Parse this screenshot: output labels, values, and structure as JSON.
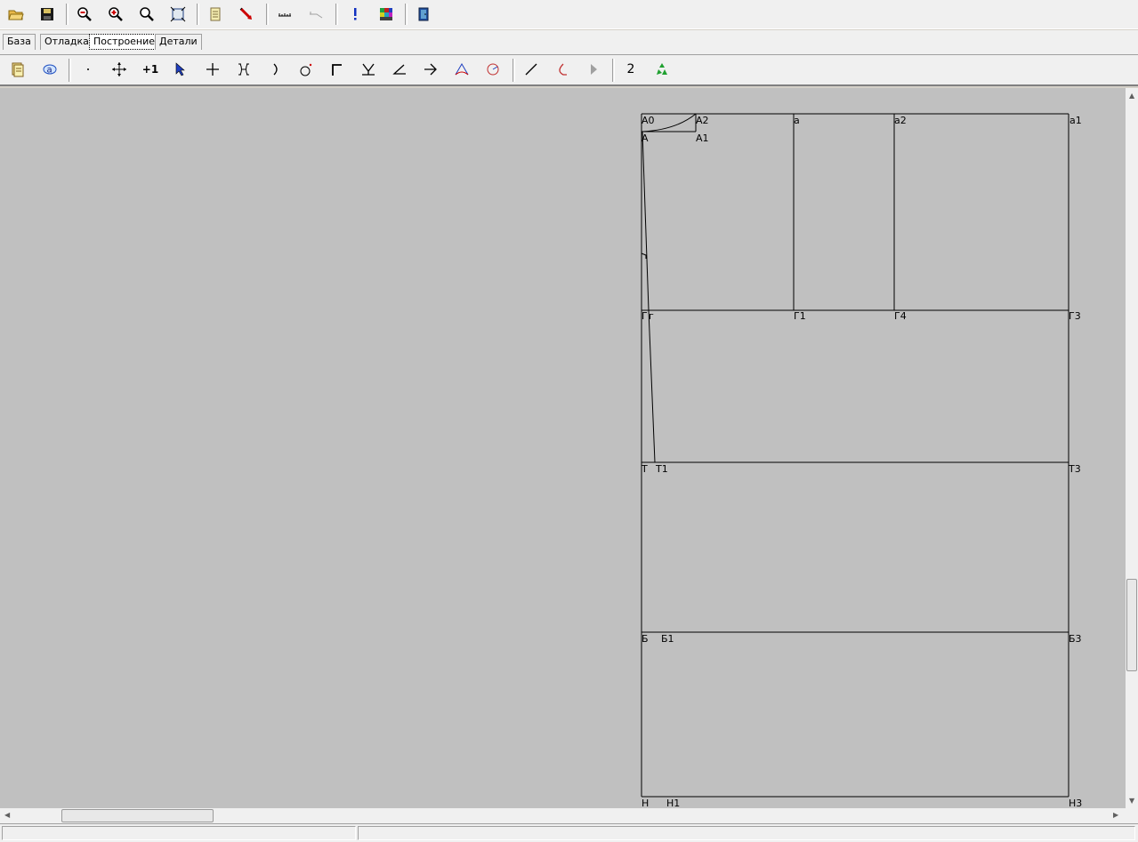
{
  "toolbar_top": {
    "buttons": [
      {
        "name": "open-folder-icon"
      },
      {
        "name": "save-icon"
      },
      {
        "name": "zoom-out-icon"
      },
      {
        "name": "zoom-in-icon"
      },
      {
        "name": "zoom-icon"
      },
      {
        "name": "fit-to-window-icon"
      },
      {
        "name": "notes-icon"
      },
      {
        "name": "pointer-red-icon"
      },
      {
        "name": "ruler-icon"
      },
      {
        "name": "measure-disabled-icon"
      },
      {
        "name": "exclamation-icon"
      },
      {
        "name": "color-table-icon"
      },
      {
        "name": "exit-door-icon"
      }
    ]
  },
  "tabs": [
    {
      "label": "База"
    },
    {
      "label": "Отладка"
    },
    {
      "label": "Построение"
    },
    {
      "label": "Детали"
    }
  ],
  "active_tab": "Построение",
  "toolbar_build": {
    "plus_one_label": "+1",
    "number_label": "2"
  },
  "drawing": {
    "points": {
      "A0": "А0",
      "A2": "А2",
      "a": "а",
      "a2": "а2",
      "a1": "а1",
      "A": "А",
      "A1": "А1",
      "G": "Г",
      "g": "г",
      "G1": "Г1",
      "G4": "Г4",
      "G3": "Г3",
      "T": "Т",
      "T1": "Т1",
      "T3": "Т3",
      "B": "Б",
      "B1": "Б1",
      "B3": "Б3",
      "H": "Н",
      "H1": "Н1",
      "H3": "Н3"
    }
  }
}
